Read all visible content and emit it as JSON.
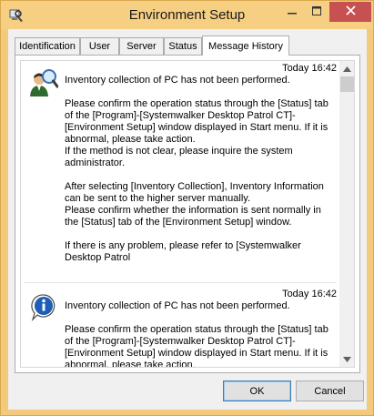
{
  "window": {
    "title": "Environment Setup",
    "minimize_icon": "minimize-icon",
    "maximize_icon": "maximize-icon",
    "close_icon": "close-icon",
    "accent_color": "#f6cf83",
    "close_color": "#c75050"
  },
  "tabs": [
    {
      "label": "Identification",
      "active": false
    },
    {
      "label": "User",
      "active": false
    },
    {
      "label": "Server",
      "active": false
    },
    {
      "label": "Status",
      "active": false
    },
    {
      "label": "Message History",
      "active": true
    }
  ],
  "messages": [
    {
      "icon": "user-search-icon",
      "time": "Today 16:42",
      "text": "Inventory collection of PC has not been performed.\n\nPlease confirm the operation status through the [Status] tab of the [Program]-[Systemwalker Desktop Patrol CT]-[Environment Setup] window displayed in Start menu. If it is abnormal, please take action.\nIf the method is not clear, please inquire the system administrator.\n\nAfter selecting [Inventory Collection], Inventory Information can be sent to the higher server manually.\nPlease confirm whether the information is sent normally in the [Status] tab of the [Environment Setup] window.\n\nIf there is any problem, please refer to [Systemwalker Desktop Patrol"
    },
    {
      "icon": "info-icon",
      "time": "Today 16:42",
      "text": "Inventory collection of PC has not been performed.\n\nPlease confirm the operation status through the [Status] tab of the [Program]-[Systemwalker Desktop Patrol CT]-[Environment Setup] window displayed in Start menu. If it is abnormal, please take action."
    }
  ],
  "buttons": {
    "ok": "OK",
    "cancel": "Cancel"
  }
}
